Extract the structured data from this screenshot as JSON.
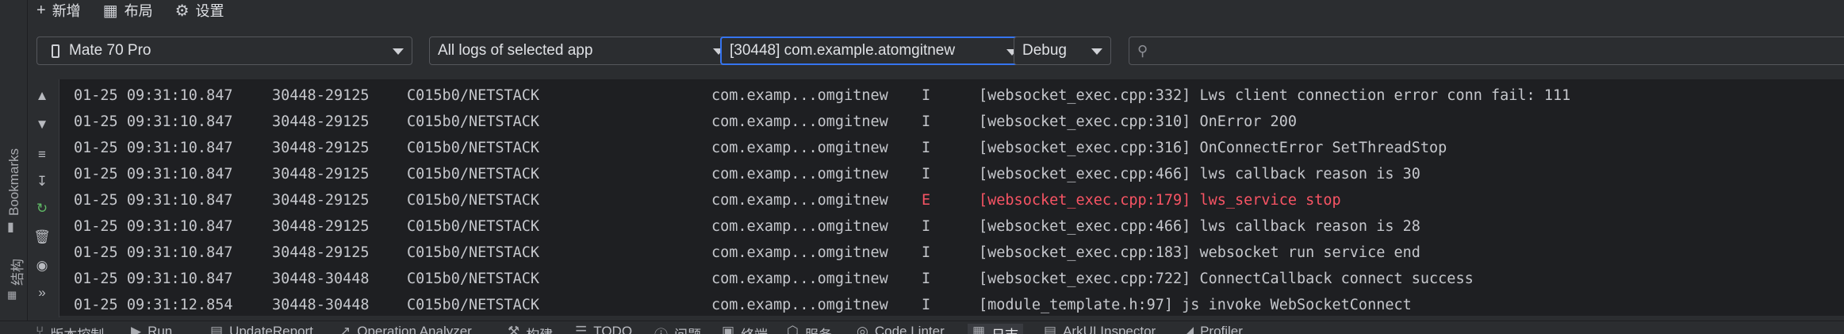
{
  "toolbar": {
    "new_label": "新增",
    "layout_label": "布局",
    "settings_label": "设置"
  },
  "left_strip": {
    "bookmarks_label": "Bookmarks",
    "structure_label": "结构"
  },
  "filters": {
    "device": "Mate 70 Pro",
    "log_scope": "All logs of selected app",
    "process": "[30448] com.example.atomgitnew",
    "level": "Debug",
    "search_placeholder": "",
    "search_value": ""
  },
  "log_toolbar": {
    "icons": [
      "arrow-up-icon",
      "arrow-down-icon",
      "soft-wrap-icon",
      "scroll-to-end-icon",
      "restart-icon",
      "trash-icon",
      "camera-icon",
      "more-icon"
    ],
    "more_label": "»"
  },
  "logs": [
    {
      "date": "01-25 09:31:10.847",
      "pid": "30448-29125",
      "tag": "C015b0/NETSTACK",
      "pkg": "com.examp...omgitnew",
      "level": "I",
      "msg": "[websocket_exec.cpp:332] Lws client connection error conn fail: 111"
    },
    {
      "date": "01-25 09:31:10.847",
      "pid": "30448-29125",
      "tag": "C015b0/NETSTACK",
      "pkg": "com.examp...omgitnew",
      "level": "I",
      "msg": "[websocket_exec.cpp:310] OnError 200"
    },
    {
      "date": "01-25 09:31:10.847",
      "pid": "30448-29125",
      "tag": "C015b0/NETSTACK",
      "pkg": "com.examp...omgitnew",
      "level": "I",
      "msg": "[websocket_exec.cpp:316] OnConnectError SetThreadStop"
    },
    {
      "date": "01-25 09:31:10.847",
      "pid": "30448-29125",
      "tag": "C015b0/NETSTACK",
      "pkg": "com.examp...omgitnew",
      "level": "I",
      "msg": "[websocket_exec.cpp:466] lws callback reason is 30"
    },
    {
      "date": "01-25 09:31:10.847",
      "pid": "30448-29125",
      "tag": "C015b0/NETSTACK",
      "pkg": "com.examp...omgitnew",
      "level": "E",
      "msg": "[websocket_exec.cpp:179] lws_service stop"
    },
    {
      "date": "01-25 09:31:10.847",
      "pid": "30448-29125",
      "tag": "C015b0/NETSTACK",
      "pkg": "com.examp...omgitnew",
      "level": "I",
      "msg": "[websocket_exec.cpp:466] lws callback reason is 28"
    },
    {
      "date": "01-25 09:31:10.847",
      "pid": "30448-29125",
      "tag": "C015b0/NETSTACK",
      "pkg": "com.examp...omgitnew",
      "level": "I",
      "msg": "[websocket_exec.cpp:183] websocket run service end"
    },
    {
      "date": "01-25 09:31:10.847",
      "pid": "30448-30448",
      "tag": "C015b0/NETSTACK",
      "pkg": "com.examp...omgitnew",
      "level": "I",
      "msg": "[websocket_exec.cpp:722] ConnectCallback connect success"
    },
    {
      "date": "01-25 09:31:12.854",
      "pid": "30448-30448",
      "tag": "C015b0/NETSTACK",
      "pkg": "com.examp...omgitnew",
      "level": "I",
      "msg": "[module_template.h:97] js invoke WebSocketConnect"
    }
  ],
  "bottom_tabs": [
    {
      "label": "版本控制",
      "icon": "branch-icon"
    },
    {
      "label": "Run",
      "icon": "run-icon"
    },
    {
      "label": "UpdateReport",
      "icon": "report-icon"
    },
    {
      "label": "Operation Analyzer",
      "icon": "analyzer-icon"
    },
    {
      "label": "构建",
      "icon": "hammer-icon"
    },
    {
      "label": "TODO",
      "icon": "todo-icon"
    },
    {
      "label": "问题",
      "icon": "problems-icon"
    },
    {
      "label": "终端",
      "icon": "terminal-icon"
    },
    {
      "label": "服务",
      "icon": "services-icon"
    },
    {
      "label": "Code Linter",
      "icon": "linter-icon"
    },
    {
      "label": "日志",
      "icon": "log-icon"
    },
    {
      "label": "ArkUI Inspector",
      "icon": "inspector-icon"
    },
    {
      "label": "Profiler",
      "icon": "profiler-icon"
    }
  ],
  "colors": {
    "error": "#f75464",
    "focus": "#3574f0",
    "log_bg": "#1e1f22",
    "panel_bg": "#2b2d30"
  }
}
